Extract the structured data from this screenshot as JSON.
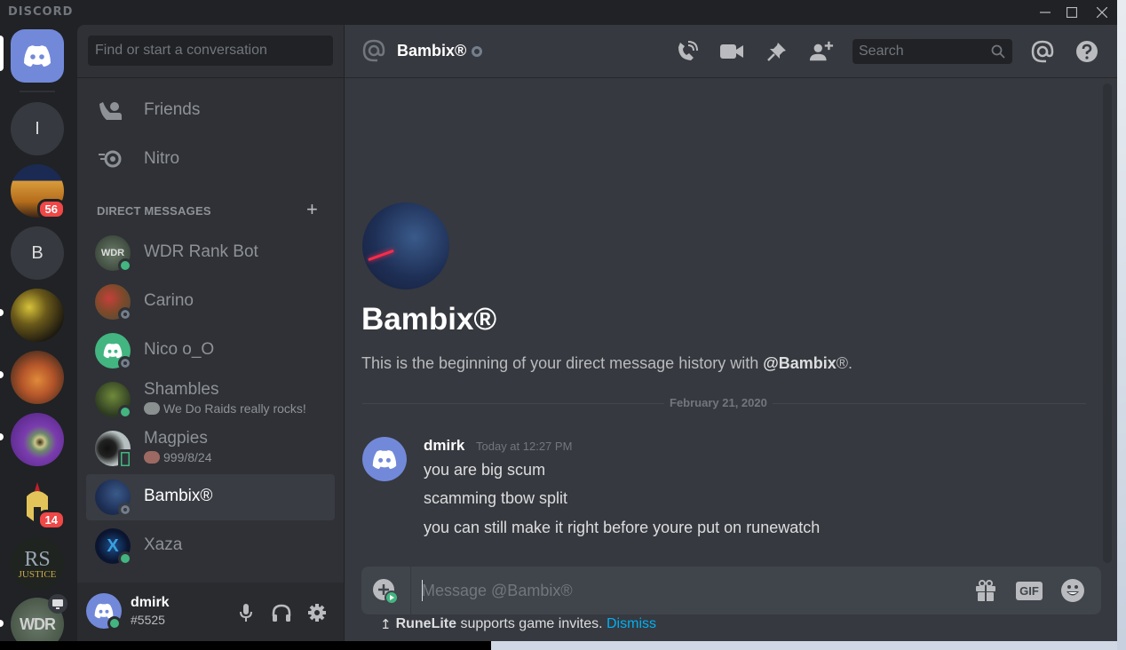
{
  "app": {
    "title": "DISCORD"
  },
  "window_controls": {
    "minimize": "minimize-icon",
    "maximize": "maximize-icon",
    "close": "close-icon"
  },
  "servers": [
    {
      "name": "Home",
      "type": "home"
    },
    {
      "name": "I",
      "type": "letter",
      "initial": "I"
    },
    {
      "name": "Parthenon server",
      "type": "image",
      "badge": "56"
    },
    {
      "name": "B",
      "type": "letter",
      "initial": "B"
    },
    {
      "name": "Gold warrior server",
      "type": "image",
      "unread": true
    },
    {
      "name": "Stew server",
      "type": "image",
      "unread": true
    },
    {
      "name": "Dragon eye server",
      "type": "image",
      "unread": true
    },
    {
      "name": "Spartan helmet server",
      "type": "image",
      "badge": "14"
    },
    {
      "name": "RS Justice",
      "type": "image",
      "text": "RS",
      "subtext": "JUSTICE"
    },
    {
      "name": "WDR",
      "type": "image",
      "text": "WDR",
      "unread": true
    }
  ],
  "sidebar": {
    "search_placeholder": "Find or start a conversation",
    "nav": [
      {
        "label": "Friends",
        "icon": "friends-icon"
      },
      {
        "label": "Nitro",
        "icon": "nitro-icon"
      }
    ],
    "dm_header": "DIRECT MESSAGES",
    "dms": [
      {
        "name": "WDR Rank Bot",
        "status": "online",
        "activity": ""
      },
      {
        "name": "Carino",
        "status": "offline",
        "activity": ""
      },
      {
        "name": "Nico o_O",
        "status": "offline",
        "activity": ""
      },
      {
        "name": "Shambles",
        "status": "online",
        "activity": "We Do Raids really rocks!"
      },
      {
        "name": "Magpies",
        "status": "mobile",
        "activity": "999/8/24"
      },
      {
        "name": "Bambix®",
        "status": "offline",
        "activity": "",
        "active": true
      },
      {
        "name": "Xaza",
        "status": "online",
        "activity": ""
      }
    ]
  },
  "user_panel": {
    "username": "dmirk",
    "discriminator": "#5525",
    "status": "online"
  },
  "header": {
    "channel_name": "Bambix®",
    "status": "offline",
    "search_placeholder": "Search",
    "icons": [
      "voice-call-icon",
      "video-call-icon",
      "pinned-messages-icon",
      "add-friend-icon",
      "mention-icon",
      "help-icon"
    ]
  },
  "welcome": {
    "title": "Bambix®",
    "desc_prefix": "This is the beginning of your direct message history with ",
    "desc_mention": "@Bambix",
    "desc_suffix": "®."
  },
  "date_divider": "February 21, 2020",
  "messages": [
    {
      "author": "dmirk",
      "timestamp": "Today at 12:27 PM",
      "lines": [
        "you are big scum",
        "scamming tbow split",
        "you can still make it right before youre put on runewatch"
      ]
    }
  ],
  "composer": {
    "placeholder": "Message @Bambix®",
    "value": "",
    "buttons": [
      "gift-icon",
      "gif-button",
      "emoji-icon"
    ],
    "gif_label": "GIF"
  },
  "hint": {
    "app": "RuneLite",
    "text": " supports game invites. ",
    "link": "Dismiss"
  },
  "colors": {
    "blurple": "#7289da",
    "online": "#43b581",
    "badge": "#f04747",
    "link": "#00b0f4"
  }
}
